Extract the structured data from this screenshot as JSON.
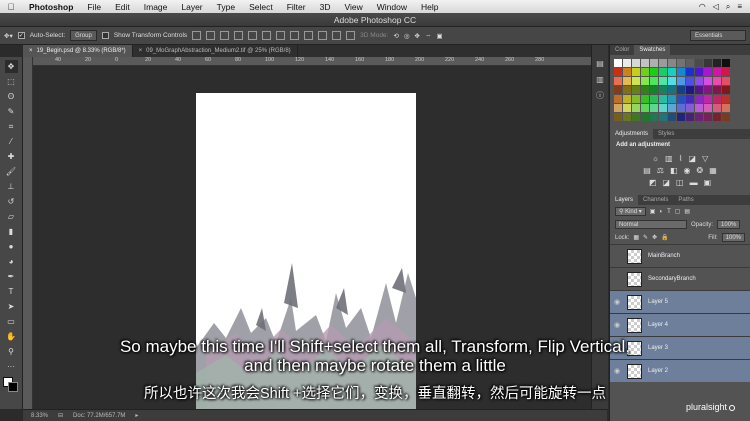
{
  "menubar": {
    "app": "Photoshop",
    "items": [
      "File",
      "Edit",
      "Image",
      "Layer",
      "Type",
      "Select",
      "Filter",
      "3D",
      "View",
      "Window",
      "Help"
    ]
  },
  "window_title": "Adobe Photoshop CC",
  "options_bar": {
    "auto_select_label": "Auto-Select:",
    "auto_select_value": "Group",
    "transform_controls_label": "Show Transform Controls",
    "mode_3d_label": "3D Mode:",
    "workspace": "Essentials"
  },
  "doc_tabs": [
    {
      "label": "19_Begin.psd @ 8.33% (RGB/8*)",
      "close": "×"
    },
    {
      "label": "09_MoGraphAbstraction_Medium2.tif @ 25% (RGB/8)",
      "close": "×"
    }
  ],
  "ruler_ticks": [
    "40",
    "20",
    "0",
    "20",
    "40",
    "60",
    "80",
    "100",
    "120",
    "140",
    "160",
    "180",
    "200",
    "220",
    "240",
    "260",
    "280"
  ],
  "status": {
    "zoom": "8.33%",
    "doc": "Doc: 77.2M/657.7M"
  },
  "panels": {
    "color_tabs": [
      "Color",
      "Swatches"
    ],
    "adjust_tabs": [
      "Adjustments",
      "Styles"
    ],
    "add_adjustment": "Add an adjustment",
    "layers_tabs": [
      "Layers",
      "Channels",
      "Paths"
    ],
    "kind_filter": "Kind",
    "blend_mode": "Normal",
    "opacity_label": "Opacity:",
    "opacity_value": "100%",
    "lock_label": "Lock:",
    "fill_label": "Fill:",
    "fill_value": "100%",
    "layers": [
      {
        "name": "MainBranch",
        "selected": false
      },
      {
        "name": "SecondaryBranch",
        "selected": false
      },
      {
        "name": "Layer 5",
        "selected": true
      },
      {
        "name": "Layer 4",
        "selected": true
      },
      {
        "name": "Layer 3",
        "selected": true
      },
      {
        "name": "Layer 2",
        "selected": true
      }
    ]
  },
  "captions": {
    "english": "So maybe this time I'll Shift+select them all, Transform, Flip Vertical, and then maybe rotate them a little",
    "chinese": "所以也许这次我会Shift +选择它们，变换，垂直翻转，然后可能旋转一点"
  },
  "watermark": "pluralsight",
  "colors": {
    "ui_dark": "#535353",
    "selected_layer": "#6d7f9b",
    "canvas_bg": "#2d2d2d"
  }
}
